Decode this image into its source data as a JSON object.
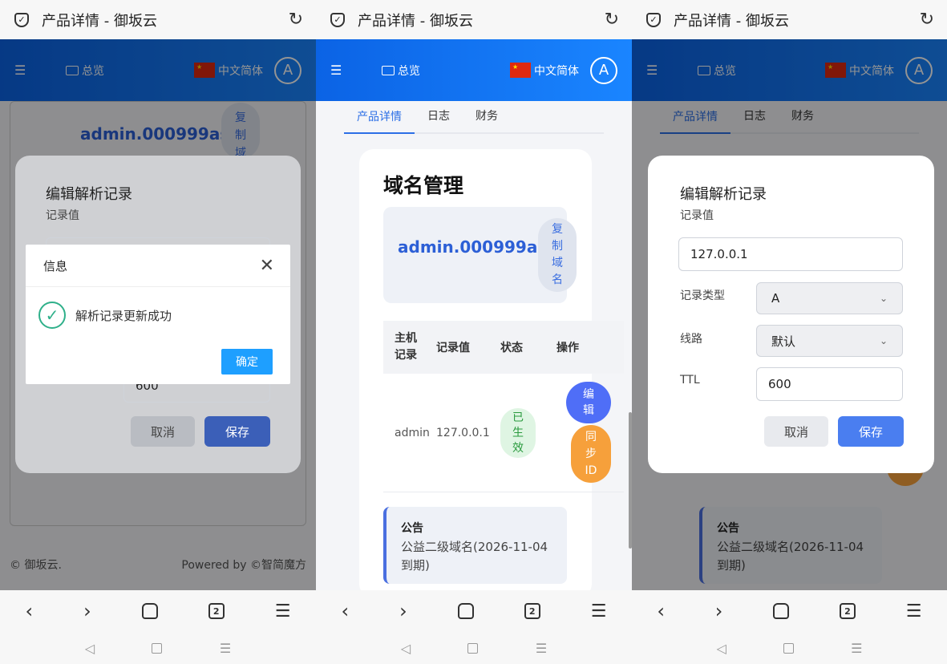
{
  "browser": {
    "title": "产品详情 - 御坂云",
    "tab_count": "2"
  },
  "app": {
    "menu_icon": "indent-icon",
    "overview_label": "总览",
    "lang_label": "中文简体",
    "avatar_letter": "A",
    "brand_color": "#0b63e5"
  },
  "tabs": [
    "产品详情",
    "日志",
    "财务"
  ],
  "domain_page": {
    "heading": "域名管理",
    "domain": "admin.000999asia",
    "copy_label": "复制域名",
    "copy_label_clipped": "复制域",
    "table": {
      "headers": [
        "主机记录",
        "记录值",
        "状态",
        "操作"
      ],
      "rows": [
        {
          "host": "admin",
          "value": "127.0.0.1",
          "status": "已生效",
          "edit": "编辑",
          "sync": "同步ID"
        }
      ]
    },
    "notice": {
      "title": "公告",
      "body": "公益二级域名(2026-11-04到期)"
    }
  },
  "footer": {
    "left": "© 御坂云.",
    "right": "Powered by ©智简魔方"
  },
  "edit_dialog": {
    "title": "编辑解析记录",
    "value_label": "记录值",
    "value": "127.0.0.1",
    "type_label": "记录类型",
    "type": "A",
    "line_label": "线路",
    "line": "默认",
    "ttl_label": "TTL",
    "ttl": "600",
    "cancel": "取消",
    "save": "保存"
  },
  "info_dialog": {
    "title": "信息",
    "message": "解析记录更新成功",
    "confirm": "确定"
  },
  "bottom_nav": {
    "back": "‹",
    "forward": "›",
    "menu": "☰"
  }
}
